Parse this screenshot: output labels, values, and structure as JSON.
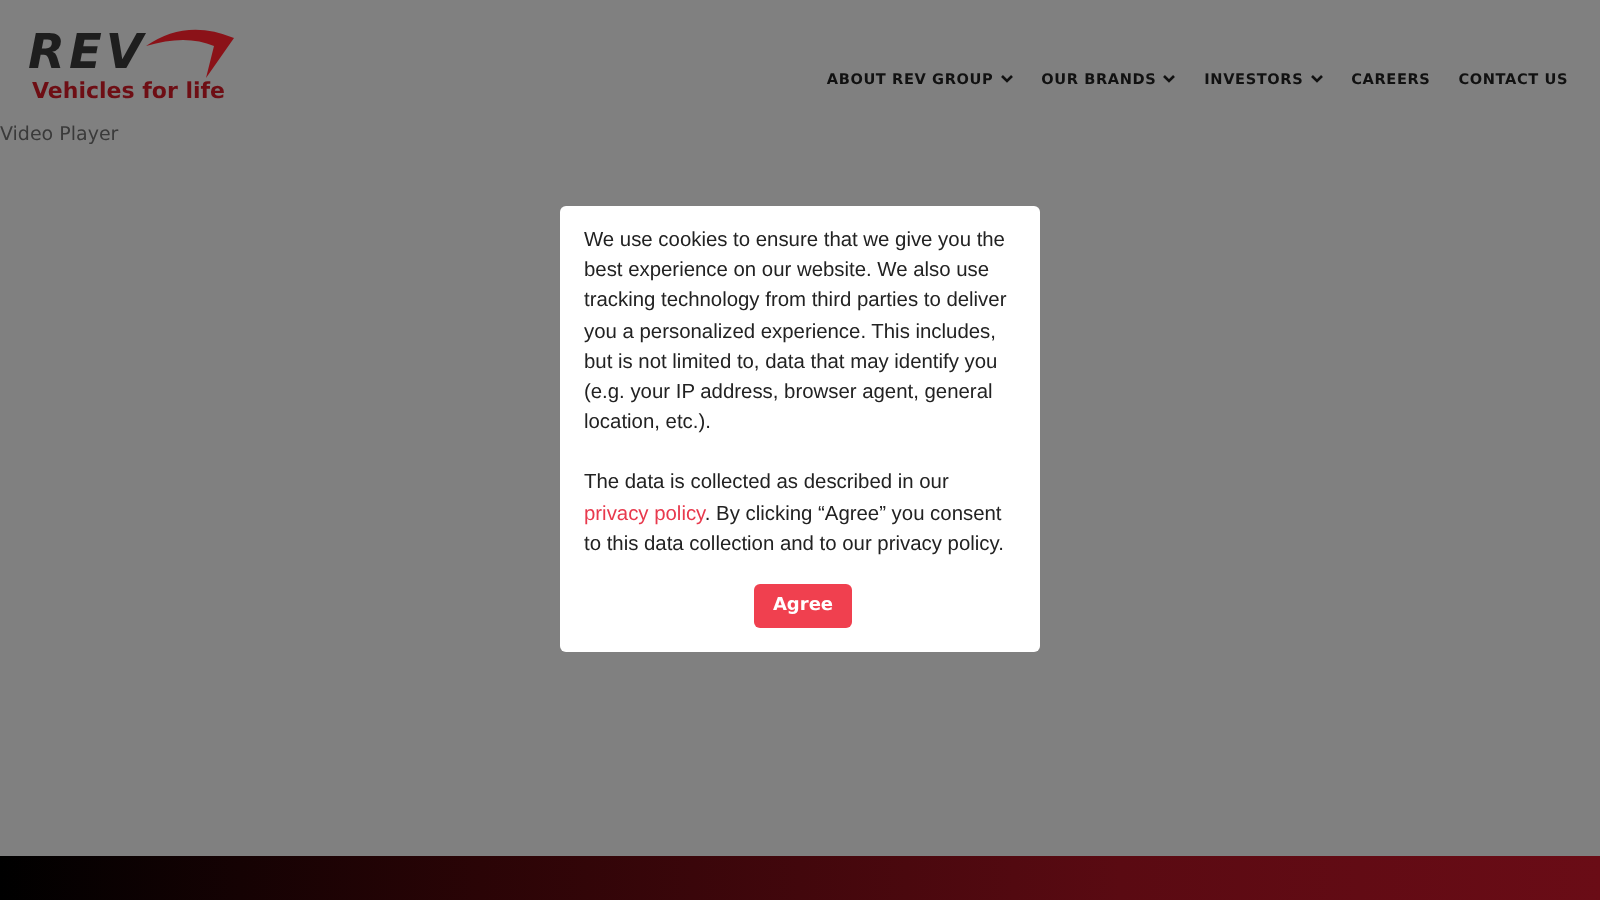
{
  "logo": {
    "mark": "REV",
    "tagline": "Vehicles for life"
  },
  "nav": [
    {
      "label": "ABOUT REV GROUP",
      "has_dropdown": true
    },
    {
      "label": "OUR BRANDS",
      "has_dropdown": true
    },
    {
      "label": "INVESTORS",
      "has_dropdown": true
    },
    {
      "label": "CAREERS",
      "has_dropdown": false
    },
    {
      "label": "CONTACT US",
      "has_dropdown": false
    }
  ],
  "video_player_label": "Video Player",
  "cookie_dialog": {
    "paragraph_1": "We use cookies to ensure that we give you the best experience on our website. We also use tracking technology from third parties to deliver you a personalized experience. This includes, but is not limited to, data that may identify you (e.g. your IP address, browser agent, general location, etc.).",
    "paragraph_2_before": "The data is collected as described in our",
    "link": "privacy policy",
    "paragraph_2_after": ". By clicking “Agree” you consent to this data collection and to our privacy policy.",
    "button": "Agree"
  }
}
